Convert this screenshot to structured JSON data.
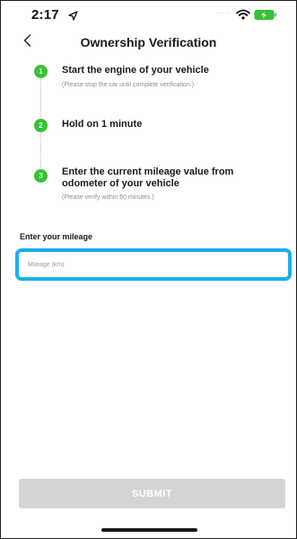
{
  "status_bar": {
    "time": "2:17",
    "signal": "·····",
    "icons": [
      "location-arrow-icon",
      "wifi-icon",
      "battery-charging-icon"
    ]
  },
  "header": {
    "title": "Ownership Verification",
    "back_icon": "chevron-left-icon"
  },
  "steps": [
    {
      "number": "1",
      "title": "Start the engine of your vehicle",
      "note": "(Please stop the car until complete verification.)"
    },
    {
      "number": "2",
      "title": "Hold on 1 minute",
      "note": ""
    },
    {
      "number": "3",
      "title": "Enter the current mileage value from odometer of your vehicle",
      "note": "(Please verify within 60 minutes.)"
    }
  ],
  "mileage": {
    "label": "Enter your mileage",
    "placeholder": "Mileage (km)",
    "value": ""
  },
  "submit": {
    "label": "SUBMIT"
  },
  "colors": {
    "step_badge": "#35c234",
    "input_border": "#1aaef0",
    "submit_disabled": "#d5d5d5"
  }
}
